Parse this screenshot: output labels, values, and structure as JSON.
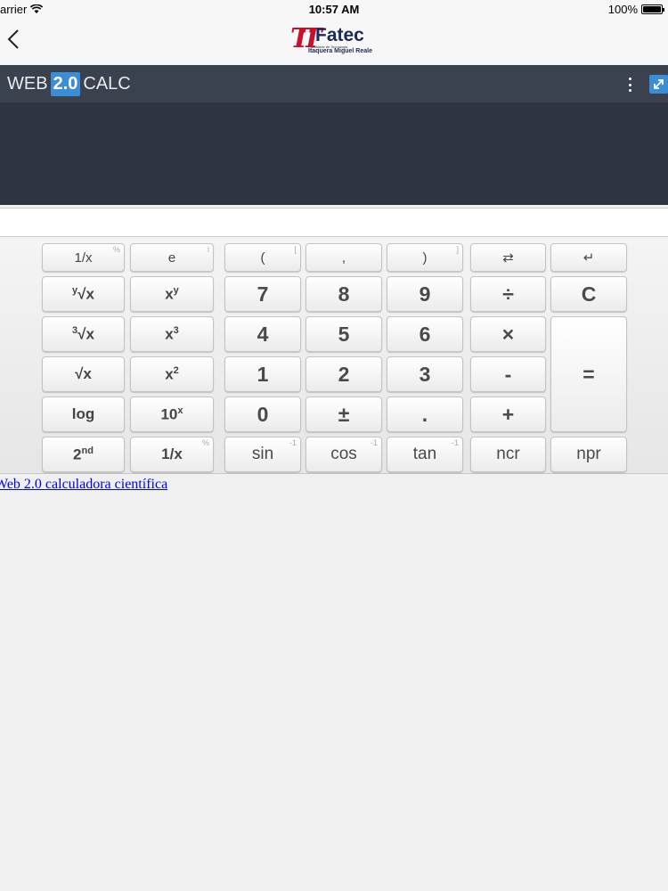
{
  "status": {
    "carrier": "arrier",
    "time": "10:57 AM",
    "battery": "100%"
  },
  "logo": {
    "name": "Fatec",
    "tagline": "Faculdade de Tecnologia",
    "campus": "Itaquera Miguel Reale"
  },
  "calc": {
    "brand_left": "WEB",
    "brand_version": "2.0",
    "brand_right": "CALC",
    "display_value": ""
  },
  "keys": {
    "r1": [
      "1/x",
      "e",
      "(",
      ",",
      ")",
      "⇄",
      "↵"
    ],
    "r1_hints": [
      "%",
      "i",
      "[",
      "",
      "]",
      "",
      ""
    ],
    "r2": [
      "x",
      "7",
      "8",
      "9",
      "÷",
      "C"
    ],
    "r3": [
      "x",
      "4",
      "5",
      "6",
      "×"
    ],
    "r4": [
      "√x",
      "x",
      "1",
      "2",
      "3",
      "-",
      "="
    ],
    "r5": [
      "log",
      "10",
      "0",
      "±",
      ".",
      "+"
    ],
    "r6": [
      "2",
      "1/x",
      "sin",
      "cos",
      "tan",
      "ncr",
      "npr"
    ],
    "r6_hints": [
      "%",
      "-1",
      "-1",
      "-1"
    ],
    "sup": {
      "y": "y",
      "three": "3",
      "two": "2",
      "x": "x",
      "nd": "nd"
    },
    "root": "√x"
  },
  "footer_link": "Web 2.0 calculadora científica",
  "colors": {
    "header_dark": "#2e3442",
    "header_bar": "#3a4250",
    "badge_blue": "#3b8ed6",
    "link": "#0000ee"
  }
}
